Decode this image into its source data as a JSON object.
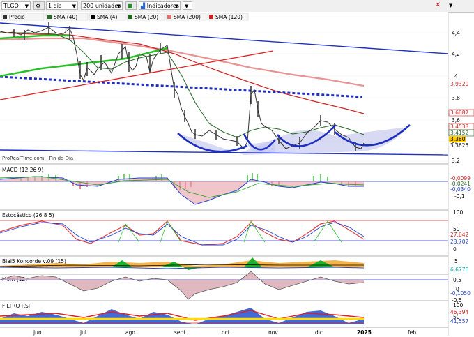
{
  "toolbar": {
    "symbol": "TLGO",
    "interval": "1 día",
    "units": "200 unidades",
    "indicators_label": "Indicadores",
    "close_glyph": "✕"
  },
  "price_panel": {
    "legend": [
      {
        "label": "Precio",
        "color": "#333333"
      },
      {
        "label": "SMA (40)",
        "color": "#2b6b2b"
      },
      {
        "label": "SMA (4)",
        "color": "#000000"
      },
      {
        "label": "SMA (20)",
        "color": "#1e6b1e"
      },
      {
        "label": "SMA (200)",
        "color": "#e07070"
      },
      {
        "label": "SMA (120)",
        "color": "#d02020"
      }
    ],
    "watermark": "ProRealTime.com - Fin de Día",
    "axis_ticks": [
      "4,4",
      "4,2",
      "4",
      "3,8",
      "3,6",
      "3,4",
      "3,2"
    ],
    "value_tags": [
      {
        "text": "3,9320",
        "color": "#d02020"
      },
      {
        "text": "3,6687",
        "color": "#d02020"
      },
      {
        "text": "3,4533",
        "color": "#d02020"
      },
      {
        "text": "3,4152",
        "color": "#1e6b1e"
      },
      {
        "text": "3,380",
        "color": "#ffcc00"
      },
      {
        "text": "3,3625",
        "color": "#000000"
      }
    ]
  },
  "macd_panel": {
    "title": "MACD (12 26 9)",
    "axis_ticks": [
      "-0,1"
    ],
    "value_tags": [
      {
        "text": "-0,0099",
        "color": "#d02020"
      },
      {
        "text": "-0,0241",
        "color": "#2b6b2b"
      },
      {
        "text": "-0,0340",
        "color": "#1e3fd0"
      }
    ]
  },
  "stoch_panel": {
    "title": "Estocástico (26 8 5)",
    "axis_ticks": [
      "100",
      "50",
      "0"
    ],
    "value_tags": [
      {
        "text": "27,642",
        "color": "#d02020"
      },
      {
        "text": "23,702",
        "color": "#1e3fd0"
      }
    ]
  },
  "koncorde_panel": {
    "title": "Blai5 Koncorde v.09 (15)",
    "axis_ticks": [
      "5"
    ],
    "value_tags": [
      {
        "text": "6,6776",
        "color": "#00a0a0"
      }
    ]
  },
  "mom_panel": {
    "title": "Mom (12)",
    "axis_ticks": [
      "0,5",
      "0",
      "-0,5"
    ],
    "value_tags": [
      {
        "text": "-0,1050",
        "color": "#1e3fd0"
      }
    ]
  },
  "rsi_panel": {
    "title": "FILTRO RSI",
    "axis_ticks": [
      "100",
      "50"
    ],
    "value_tags": [
      {
        "text": "46,394",
        "color": "#d02020"
      },
      {
        "text": "41,557",
        "color": "#1e3fd0"
      }
    ]
  },
  "date_axis": [
    "jun",
    "jul",
    "ago",
    "sept",
    "oct",
    "nov",
    "dic",
    "2025",
    "feb"
  ]
}
